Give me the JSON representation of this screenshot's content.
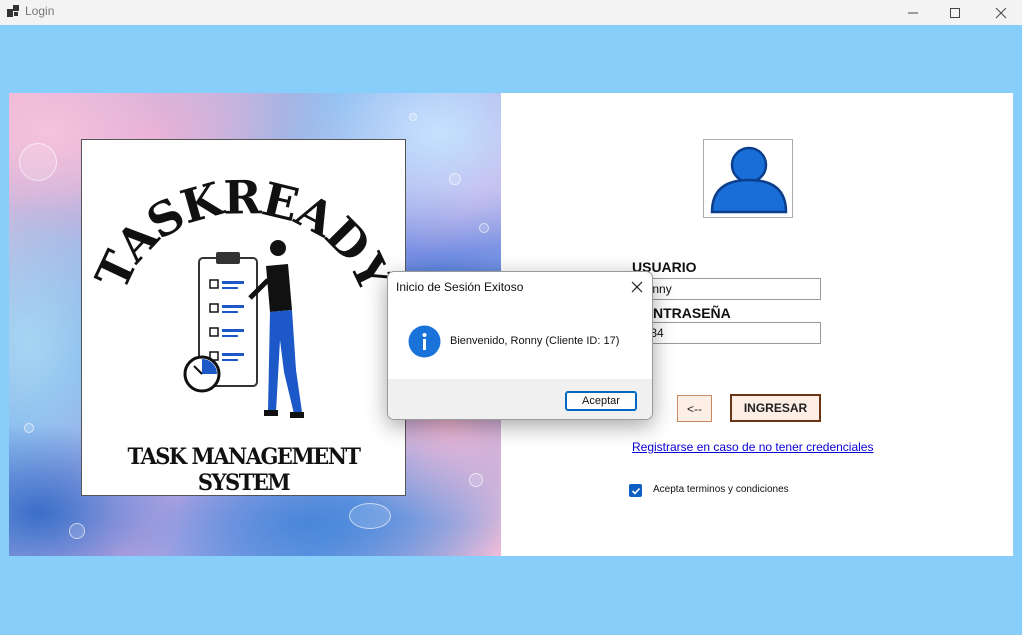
{
  "window": {
    "title": "Login",
    "icon": "app-window-icon",
    "controls": [
      "minimize-icon",
      "maximize-icon",
      "close-icon"
    ]
  },
  "logo": {
    "title": "TASKREADY",
    "subtitle": "TASK MANAGEMENT SYSTEM"
  },
  "form": {
    "avatar_icon": "user-icon",
    "username_label": "USUARIO",
    "username_value": "Ronny",
    "password_label": "CONTRASEÑA",
    "password_value": "1234",
    "back_label": "<--",
    "login_label": "INGRESAR",
    "register_link": "Registrarse en caso de no tener credenciales",
    "terms_label": "Acepta terminos y condiciones",
    "terms_checked": true
  },
  "dialog": {
    "title": "Inicio de Sesión Exitoso",
    "message": "Bienvenido, Ronny (Cliente ID: 17)",
    "ok_label": "Aceptar",
    "icon": "info-icon"
  },
  "colors": {
    "background": "#87cefa",
    "link": "#0a00d6",
    "accent_blue": "#0e5fc4",
    "button_border": "#6b3515"
  }
}
